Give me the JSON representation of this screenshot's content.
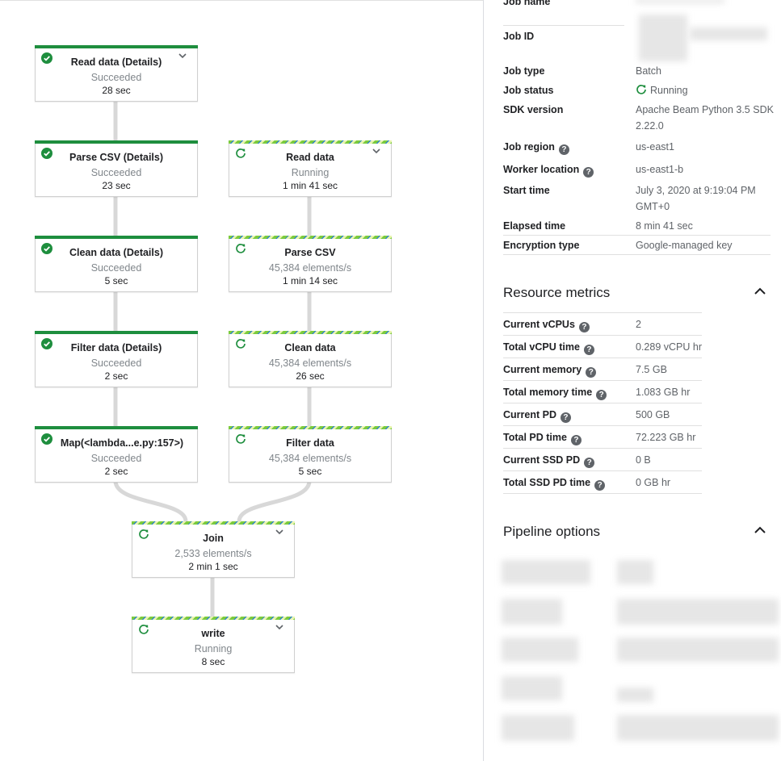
{
  "graph": {
    "steps": [
      {
        "name": "Read data (Details)",
        "state": "Succeeded",
        "time": "28 sec",
        "status": "succeeded"
      },
      {
        "name": "Parse CSV (Details)",
        "state": "Succeeded",
        "time": "23 sec",
        "status": "succeeded"
      },
      {
        "name": "Clean data (Details)",
        "state": "Succeeded",
        "time": "5 sec",
        "status": "succeeded"
      },
      {
        "name": "Filter data (Details)",
        "state": "Succeeded",
        "time": "2 sec",
        "status": "succeeded"
      },
      {
        "name": "Map(<lambda...e.py:157>)",
        "state": "Succeeded",
        "time": "2 sec",
        "status": "succeeded"
      },
      {
        "name": "Read data",
        "state": "Running",
        "time": "1 min 41 sec",
        "status": "running"
      },
      {
        "name": "Parse CSV",
        "state": "45,384 elements/s",
        "time": "1 min 14 sec",
        "status": "running"
      },
      {
        "name": "Clean data",
        "state": "45,384 elements/s",
        "time": "26 sec",
        "status": "running"
      },
      {
        "name": "Filter data",
        "state": "45,384 elements/s",
        "time": "5 sec",
        "status": "running"
      },
      {
        "name": "Join",
        "state": "2,533 elements/s",
        "time": "2 min 1 sec",
        "status": "running"
      },
      {
        "name": "write",
        "state": "Running",
        "time": "8 sec",
        "status": "running"
      }
    ]
  },
  "job_info": {
    "rows": [
      {
        "label": "Job name",
        "value": ""
      },
      {
        "label": "Job ID",
        "value": ""
      },
      {
        "label": "Job type",
        "value": "Batch"
      },
      {
        "label": "Job status",
        "value": "Running"
      },
      {
        "label": "SDK version",
        "value": "Apache Beam Python 3.5 SDK 2.22.0"
      },
      {
        "label": "Job region",
        "value": "us-east1"
      },
      {
        "label": "Worker location",
        "value": "us-east1-b"
      },
      {
        "label": "Start time",
        "value": "July 3, 2020 at 9:19:04 PM GMT+0"
      },
      {
        "label": "Elapsed time",
        "value": "8 min 41 sec"
      },
      {
        "label": "Encryption type",
        "value": "Google-managed key"
      }
    ]
  },
  "resource_metrics": {
    "title": "Resource metrics",
    "rows": [
      {
        "label": "Current vCPUs",
        "value": "2"
      },
      {
        "label": "Total vCPU time",
        "value": "0.289 vCPU hr"
      },
      {
        "label": "Current memory",
        "value": "7.5 GB"
      },
      {
        "label": "Total memory time",
        "value": "1.083 GB hr"
      },
      {
        "label": "Current PD",
        "value": "500 GB"
      },
      {
        "label": "Total PD time",
        "value": "72.223 GB hr"
      },
      {
        "label": "Current SSD PD",
        "value": "0 B"
      },
      {
        "label": "Total SSD PD time",
        "value": "0 GB hr"
      }
    ]
  },
  "pipeline_options": {
    "title": "Pipeline options"
  },
  "icons": {
    "succeeded": "check-circle-icon",
    "running": "refresh-icon",
    "expand": "chevron-down-icon",
    "collapse": "chevron-up-icon",
    "help": "help-icon"
  },
  "colors": {
    "success": "#1e8e3e",
    "running_stripe": "#7ccb3e",
    "accent": "#1a73e8"
  }
}
